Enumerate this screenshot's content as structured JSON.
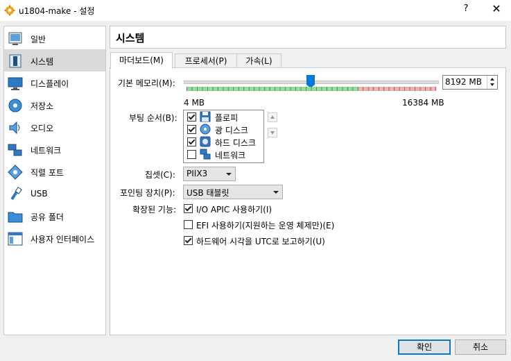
{
  "window": {
    "title": "u1804-make - 설정",
    "help": "?",
    "close": "✕"
  },
  "sidebar": {
    "items": [
      {
        "label": "일반",
        "icon": "general-icon"
      },
      {
        "label": "시스템",
        "icon": "system-icon",
        "selected": true
      },
      {
        "label": "디스플레이",
        "icon": "display-icon"
      },
      {
        "label": "저장소",
        "icon": "storage-icon"
      },
      {
        "label": "오디오",
        "icon": "audio-icon"
      },
      {
        "label": "네트워크",
        "icon": "network-icon"
      },
      {
        "label": "직렬 포트",
        "icon": "serial-port-icon"
      },
      {
        "label": "USB",
        "icon": "usb-icon"
      },
      {
        "label": "공유 폴더",
        "icon": "shared-folder-icon"
      },
      {
        "label": "사용자 인터페이스",
        "icon": "user-interface-icon"
      }
    ]
  },
  "page_title": "시스템",
  "tabs": [
    {
      "label": "마더보드(M)",
      "active": true
    },
    {
      "label": "프로세서(P)",
      "active": false
    },
    {
      "label": "가속(L)",
      "active": false
    }
  ],
  "memory": {
    "label": "기본 메모리(M):",
    "value": "8192 MB",
    "min_label": "4 MB",
    "max_label": "16384 MB",
    "min_mb": 4,
    "max_mb": 16384,
    "current_mb": 8192,
    "colors": {
      "safe": "#8ee28e",
      "warn": "#f4b0a4"
    }
  },
  "boot": {
    "label": "부팅 순서(B):",
    "items": [
      {
        "label": "플로피",
        "checked": true,
        "icon": "floppy-icon"
      },
      {
        "label": "광 디스크",
        "checked": true,
        "icon": "optical-disk-icon"
      },
      {
        "label": "하드 디스크",
        "checked": true,
        "icon": "hard-disk-icon"
      },
      {
        "label": "네트워크",
        "checked": false,
        "icon": "network-icon"
      }
    ]
  },
  "chipset": {
    "label": "칩셋(C):",
    "value": "PIIX3"
  },
  "pointing": {
    "label": "포인팅 장치(P):",
    "value": "USB 태블릿"
  },
  "ext": {
    "label": "확장된 기능:",
    "options": [
      {
        "label": "I/O APIC 사용하기(I)",
        "checked": true
      },
      {
        "label": "EFI 사용하기(지원하는 운영 체제만)(E)",
        "checked": false
      },
      {
        "label": "하드웨어 시각을 UTC로 보고하기(U)",
        "checked": true
      }
    ]
  },
  "buttons": {
    "ok": "확인",
    "cancel": "취소"
  },
  "colors": {
    "accent": "#0078d7",
    "selection": "#d9d9d9"
  }
}
